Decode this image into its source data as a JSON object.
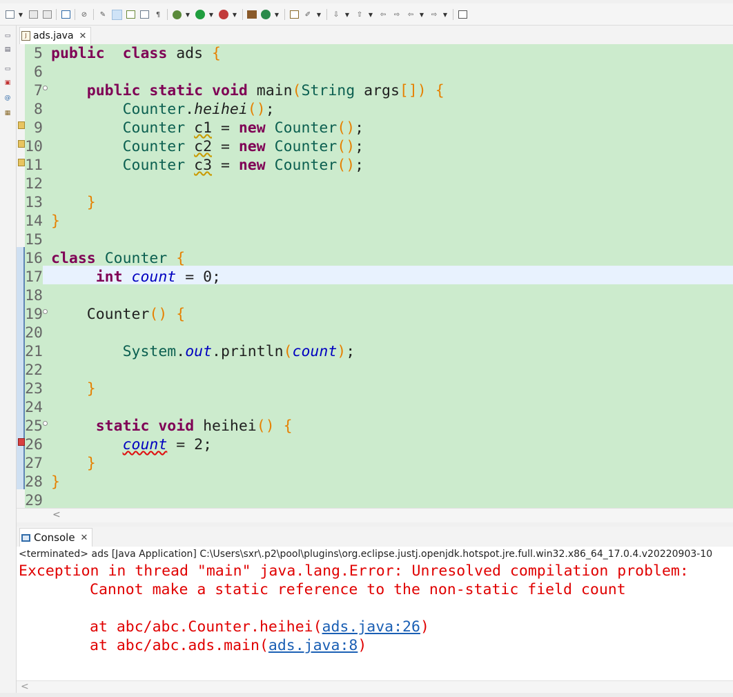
{
  "editor": {
    "tab_label": "ads.java",
    "lines": [
      {
        "n": "5",
        "parts": [
          [
            "kw",
            "public"
          ],
          [
            "",
            "  "
          ],
          [
            "kw",
            "class"
          ],
          [
            "",
            " ads "
          ],
          [
            "br",
            "{"
          ]
        ]
      },
      {
        "n": "6",
        "parts": []
      },
      {
        "n": "7",
        "parts": [
          [
            "",
            "    "
          ],
          [
            "kw",
            "public"
          ],
          [
            "",
            " "
          ],
          [
            "kw",
            "static"
          ],
          [
            "",
            " "
          ],
          [
            "kw",
            "void"
          ],
          [
            "",
            " main"
          ],
          [
            "br",
            "("
          ],
          [
            "ty",
            "String"
          ],
          [
            "",
            " args"
          ],
          [
            "br",
            "[]"
          ],
          [
            "br",
            ")"
          ],
          [
            "",
            " "
          ],
          [
            "br",
            "{"
          ]
        ]
      },
      {
        "n": "8",
        "parts": [
          [
            "",
            "        "
          ],
          [
            "ty",
            "Counter"
          ],
          [
            "",
            "."
          ],
          [
            "it",
            "heihei"
          ],
          [
            "br",
            "()"
          ],
          [
            "",
            ";"
          ]
        ]
      },
      {
        "n": "9",
        "parts": [
          [
            "",
            "        "
          ],
          [
            "ty",
            "Counter"
          ],
          [
            "",
            " "
          ],
          [
            "warn",
            "c1"
          ],
          [
            "",
            " = "
          ],
          [
            "kw",
            "new"
          ],
          [
            "",
            " "
          ],
          [
            "ty",
            "Counter"
          ],
          [
            "br",
            "()"
          ],
          [
            "",
            ";"
          ]
        ]
      },
      {
        "n": "10",
        "parts": [
          [
            "",
            "        "
          ],
          [
            "ty",
            "Counter"
          ],
          [
            "",
            " "
          ],
          [
            "warn",
            "c2"
          ],
          [
            "",
            " = "
          ],
          [
            "kw",
            "new"
          ],
          [
            "",
            " "
          ],
          [
            "ty",
            "Counter"
          ],
          [
            "br",
            "()"
          ],
          [
            "",
            ";"
          ]
        ]
      },
      {
        "n": "11",
        "parts": [
          [
            "",
            "        "
          ],
          [
            "ty",
            "Counter"
          ],
          [
            "",
            " "
          ],
          [
            "warn",
            "c3"
          ],
          [
            "",
            " = "
          ],
          [
            "kw",
            "new"
          ],
          [
            "",
            " "
          ],
          [
            "ty",
            "Counter"
          ],
          [
            "br",
            "()"
          ],
          [
            "",
            ";"
          ]
        ]
      },
      {
        "n": "12",
        "parts": []
      },
      {
        "n": "13",
        "parts": [
          [
            "",
            "    "
          ],
          [
            "br",
            "}"
          ]
        ]
      },
      {
        "n": "14",
        "parts": [
          [
            "br",
            "}"
          ]
        ]
      },
      {
        "n": "15",
        "parts": []
      },
      {
        "n": "16",
        "parts": [
          [
            "kw",
            "class"
          ],
          [
            "",
            " "
          ],
          [
            "ty",
            "Counter"
          ],
          [
            "",
            " "
          ],
          [
            "br",
            "{"
          ]
        ]
      },
      {
        "n": "17",
        "parts": [
          [
            "",
            "     "
          ],
          [
            "kw",
            "int"
          ],
          [
            "",
            " "
          ],
          [
            "fldc",
            "count"
          ],
          [
            "",
            " = 0;"
          ]
        ]
      },
      {
        "n": "18",
        "parts": []
      },
      {
        "n": "19",
        "parts": [
          [
            "",
            "    "
          ],
          [
            "",
            "Counter"
          ],
          [
            "br",
            "()"
          ],
          [
            "",
            " "
          ],
          [
            "br",
            "{"
          ]
        ]
      },
      {
        "n": "20",
        "parts": []
      },
      {
        "n": "21",
        "parts": [
          [
            "",
            "        "
          ],
          [
            "ty",
            "System"
          ],
          [
            "",
            "."
          ],
          [
            "fld",
            "out"
          ],
          [
            "",
            ".println"
          ],
          [
            "br",
            "("
          ],
          [
            "fldc",
            "count"
          ],
          [
            "br",
            ")"
          ],
          [
            "",
            ";"
          ]
        ]
      },
      {
        "n": "22",
        "parts": []
      },
      {
        "n": "23",
        "parts": [
          [
            "",
            "    "
          ],
          [
            "br",
            "}"
          ]
        ]
      },
      {
        "n": "24",
        "parts": []
      },
      {
        "n": "25",
        "parts": [
          [
            "",
            "     "
          ],
          [
            "kw",
            "static"
          ],
          [
            "",
            " "
          ],
          [
            "kw",
            "void"
          ],
          [
            "",
            " heihei"
          ],
          [
            "br",
            "()"
          ],
          [
            "",
            " "
          ],
          [
            "br",
            "{"
          ]
        ]
      },
      {
        "n": "26",
        "parts": [
          [
            "",
            "        "
          ],
          [
            "errw",
            "count"
          ],
          [
            "",
            " = 2;"
          ]
        ]
      },
      {
        "n": "27",
        "parts": [
          [
            "",
            "    "
          ],
          [
            "br",
            "}"
          ]
        ]
      },
      {
        "n": "28",
        "parts": [
          [
            "br",
            "}"
          ]
        ]
      },
      {
        "n": "29",
        "parts": []
      }
    ]
  },
  "console": {
    "tab_label": "Console",
    "status": "<terminated> ads [Java Application] C:\\Users\\sxr\\.p2\\pool\\plugins\\org.eclipse.justj.openjdk.hotspot.jre.full.win32.x86_64_17.0.4.v20220903-10",
    "error_line1": "Exception in thread \"main\" java.lang.Error: Unresolved compilation problem: ",
    "error_line2": "\tCannot make a static reference to the non-static field count",
    "trace1_prefix": "\tat abc/abc.Counter.heihei(",
    "trace1_link": "ads.java:26",
    "trace1_suffix": ")",
    "trace2_prefix": "\tat abc/abc.ads.main(",
    "trace2_link": "ads.java:8",
    "trace2_suffix": ")"
  },
  "colors": {
    "editor_bg": "#ccebcd",
    "current_line": "#e8f2fe",
    "keyword": "#7f0055",
    "type": "#0b5f50",
    "field": "#0000c0",
    "bracket": "#e68000",
    "error_text": "#e00000",
    "link": "#1a5fb4"
  }
}
